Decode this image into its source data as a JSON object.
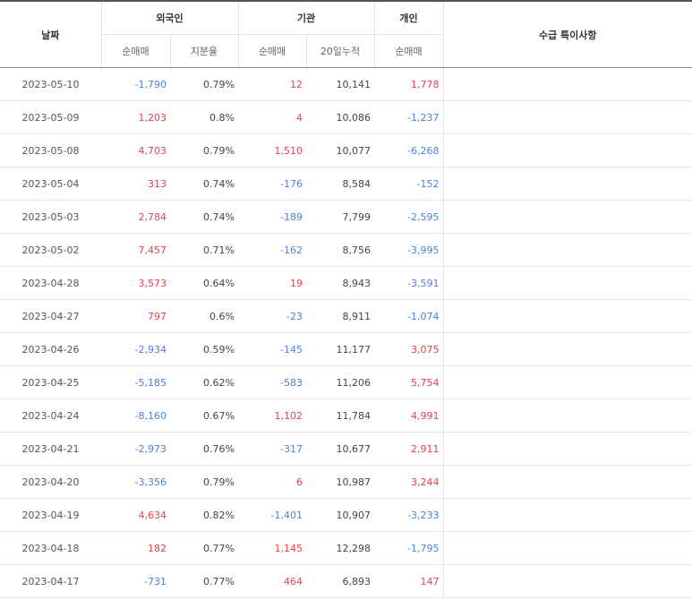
{
  "header": {
    "date": "날짜",
    "foreign": "외국인",
    "institution": "기관",
    "individual": "개인",
    "note": "수급 특이사항",
    "net_buy": "순매매",
    "share_ratio": "지분율",
    "cum20": "20일누적"
  },
  "rows": [
    {
      "date": "2023-05-10",
      "foreign_net": "-1,790",
      "foreign_ratio": "0.79%",
      "inst_net": "12",
      "inst_cum": "10,141",
      "indiv_net": "1,778"
    },
    {
      "date": "2023-05-09",
      "foreign_net": "1,203",
      "foreign_ratio": "0.8%",
      "inst_net": "4",
      "inst_cum": "10,086",
      "indiv_net": "-1,237"
    },
    {
      "date": "2023-05-08",
      "foreign_net": "4,703",
      "foreign_ratio": "0.79%",
      "inst_net": "1,510",
      "inst_cum": "10,077",
      "indiv_net": "-6,268"
    },
    {
      "date": "2023-05-04",
      "foreign_net": "313",
      "foreign_ratio": "0.74%",
      "inst_net": "-176",
      "inst_cum": "8,584",
      "indiv_net": "-152"
    },
    {
      "date": "2023-05-03",
      "foreign_net": "2,784",
      "foreign_ratio": "0.74%",
      "inst_net": "-189",
      "inst_cum": "7,799",
      "indiv_net": "-2,595"
    },
    {
      "date": "2023-05-02",
      "foreign_net": "7,457",
      "foreign_ratio": "0.71%",
      "inst_net": "-162",
      "inst_cum": "8,756",
      "indiv_net": "-3,995"
    },
    {
      "date": "2023-04-28",
      "foreign_net": "3,573",
      "foreign_ratio": "0.64%",
      "inst_net": "19",
      "inst_cum": "8,943",
      "indiv_net": "-3,591"
    },
    {
      "date": "2023-04-27",
      "foreign_net": "797",
      "foreign_ratio": "0.6%",
      "inst_net": "-23",
      "inst_cum": "8,911",
      "indiv_net": "-1,074"
    },
    {
      "date": "2023-04-26",
      "foreign_net": "-2,934",
      "foreign_ratio": "0.59%",
      "inst_net": "-145",
      "inst_cum": "11,177",
      "indiv_net": "3,075"
    },
    {
      "date": "2023-04-25",
      "foreign_net": "-5,185",
      "foreign_ratio": "0.62%",
      "inst_net": "-583",
      "inst_cum": "11,206",
      "indiv_net": "5,754"
    },
    {
      "date": "2023-04-24",
      "foreign_net": "-8,160",
      "foreign_ratio": "0.67%",
      "inst_net": "1,102",
      "inst_cum": "11,784",
      "indiv_net": "4,991"
    },
    {
      "date": "2023-04-21",
      "foreign_net": "-2,973",
      "foreign_ratio": "0.76%",
      "inst_net": "-317",
      "inst_cum": "10,677",
      "indiv_net": "2,911"
    },
    {
      "date": "2023-04-20",
      "foreign_net": "-3,356",
      "foreign_ratio": "0.79%",
      "inst_net": "6",
      "inst_cum": "10,987",
      "indiv_net": "3,244"
    },
    {
      "date": "2023-04-19",
      "foreign_net": "4,634",
      "foreign_ratio": "0.82%",
      "inst_net": "-1,401",
      "inst_cum": "10,907",
      "indiv_net": "-3,233"
    },
    {
      "date": "2023-04-18",
      "foreign_net": "182",
      "foreign_ratio": "0.77%",
      "inst_net": "1,145",
      "inst_cum": "12,298",
      "indiv_net": "-1,795"
    },
    {
      "date": "2023-04-17",
      "foreign_net": "-731",
      "foreign_ratio": "0.77%",
      "inst_net": "464",
      "inst_cum": "6,893",
      "indiv_net": "147"
    }
  ],
  "colors": {
    "positive": "#e8414a",
    "negative": "#4d7fd9"
  }
}
